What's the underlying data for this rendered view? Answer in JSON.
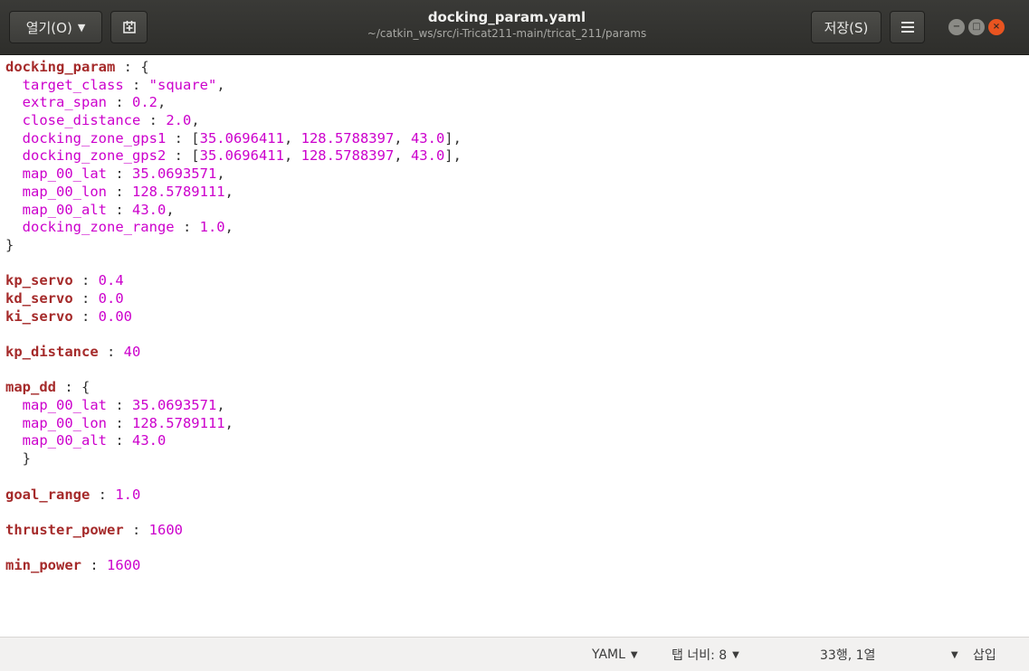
{
  "headerbar": {
    "open_label": "열기(O)",
    "pin_icon": "new-tab-icon",
    "title": "docking_param.yaml",
    "subtitle": "~/catkin_ws/src/i-Tricat211-main/tricat_211/params",
    "save_label": "저장(S)",
    "menu_icon": "hamburger-menu-icon"
  },
  "window_controls": {
    "minimize": "−",
    "maximize": "□",
    "close": "×"
  },
  "editor": {
    "lines": [
      [
        {
          "t": "docking_param",
          "c": "key-top"
        },
        {
          "t": " : {",
          "c": "punct"
        }
      ],
      [
        {
          "t": "  target_class",
          "c": "key-nested"
        },
        {
          "t": " : ",
          "c": "punct"
        },
        {
          "t": "\"square\"",
          "c": "str"
        },
        {
          "t": ",",
          "c": "punct"
        }
      ],
      [
        {
          "t": "  extra_span",
          "c": "key-nested"
        },
        {
          "t": " : ",
          "c": "punct"
        },
        {
          "t": "0.2",
          "c": "num"
        },
        {
          "t": ",",
          "c": "punct"
        }
      ],
      [
        {
          "t": "  close_distance",
          "c": "key-nested"
        },
        {
          "t": " : ",
          "c": "punct"
        },
        {
          "t": "2.0",
          "c": "num"
        },
        {
          "t": ",",
          "c": "punct"
        }
      ],
      [
        {
          "t": "  docking_zone_gps1",
          "c": "key-nested"
        },
        {
          "t": " : [",
          "c": "punct"
        },
        {
          "t": "35.0696411",
          "c": "num"
        },
        {
          "t": ", ",
          "c": "punct"
        },
        {
          "t": "128.5788397",
          "c": "num"
        },
        {
          "t": ", ",
          "c": "punct"
        },
        {
          "t": "43.0",
          "c": "num"
        },
        {
          "t": "],",
          "c": "punct"
        }
      ],
      [
        {
          "t": "  docking_zone_gps2",
          "c": "key-nested"
        },
        {
          "t": " : [",
          "c": "punct"
        },
        {
          "t": "35.0696411",
          "c": "num"
        },
        {
          "t": ", ",
          "c": "punct"
        },
        {
          "t": "128.5788397",
          "c": "num"
        },
        {
          "t": ", ",
          "c": "punct"
        },
        {
          "t": "43.0",
          "c": "num"
        },
        {
          "t": "],",
          "c": "punct"
        }
      ],
      [
        {
          "t": "  map_00_lat",
          "c": "key-nested"
        },
        {
          "t": " : ",
          "c": "punct"
        },
        {
          "t": "35.0693571",
          "c": "num"
        },
        {
          "t": ",",
          "c": "punct"
        }
      ],
      [
        {
          "t": "  map_00_lon",
          "c": "key-nested"
        },
        {
          "t": " : ",
          "c": "punct"
        },
        {
          "t": "128.5789111",
          "c": "num"
        },
        {
          "t": ",",
          "c": "punct"
        }
      ],
      [
        {
          "t": "  map_00_alt",
          "c": "key-nested"
        },
        {
          "t": " : ",
          "c": "punct"
        },
        {
          "t": "43.0",
          "c": "num"
        },
        {
          "t": ",",
          "c": "punct"
        }
      ],
      [
        {
          "t": "  docking_zone_range",
          "c": "key-nested"
        },
        {
          "t": " : ",
          "c": "punct"
        },
        {
          "t": "1.0",
          "c": "num"
        },
        {
          "t": ",",
          "c": "punct"
        }
      ],
      [
        {
          "t": "}",
          "c": "punct"
        }
      ],
      [],
      [
        {
          "t": "kp_servo",
          "c": "key-top"
        },
        {
          "t": " : ",
          "c": "punct"
        },
        {
          "t": "0.4",
          "c": "num"
        }
      ],
      [
        {
          "t": "kd_servo",
          "c": "key-top"
        },
        {
          "t": " : ",
          "c": "punct"
        },
        {
          "t": "0.0",
          "c": "num"
        }
      ],
      [
        {
          "t": "ki_servo",
          "c": "key-top"
        },
        {
          "t": " : ",
          "c": "punct"
        },
        {
          "t": "0.00",
          "c": "num"
        }
      ],
      [],
      [
        {
          "t": "kp_distance",
          "c": "key-top"
        },
        {
          "t": " : ",
          "c": "punct"
        },
        {
          "t": "40",
          "c": "num"
        }
      ],
      [],
      [
        {
          "t": "map_dd",
          "c": "key-top"
        },
        {
          "t": " : {",
          "c": "punct"
        }
      ],
      [
        {
          "t": "  map_00_lat",
          "c": "key-nested"
        },
        {
          "t": " : ",
          "c": "punct"
        },
        {
          "t": "35.0693571",
          "c": "num"
        },
        {
          "t": ",",
          "c": "punct"
        }
      ],
      [
        {
          "t": "  map_00_lon",
          "c": "key-nested"
        },
        {
          "t": " : ",
          "c": "punct"
        },
        {
          "t": "128.5789111",
          "c": "num"
        },
        {
          "t": ",",
          "c": "punct"
        }
      ],
      [
        {
          "t": "  map_00_alt",
          "c": "key-nested"
        },
        {
          "t": " : ",
          "c": "punct"
        },
        {
          "t": "43.0",
          "c": "num"
        }
      ],
      [
        {
          "t": "  }",
          "c": "punct"
        }
      ],
      [],
      [
        {
          "t": "goal_range",
          "c": "key-top"
        },
        {
          "t": " : ",
          "c": "punct"
        },
        {
          "t": "1.0",
          "c": "num"
        }
      ],
      [],
      [
        {
          "t": "thruster_power",
          "c": "key-top"
        },
        {
          "t": " : ",
          "c": "punct"
        },
        {
          "t": "1600",
          "c": "num"
        }
      ],
      [],
      [
        {
          "t": "min_power",
          "c": "key-top"
        },
        {
          "t": " : ",
          "c": "punct"
        },
        {
          "t": "1600",
          "c": "num"
        }
      ],
      [],
      [],
      []
    ]
  },
  "statusbar": {
    "language": "YAML",
    "tab_width": "탭 너비: 8",
    "cursor_position": "33행, 1열",
    "insert_mode": "삽입"
  },
  "colors": {
    "top_key": "#a52a2a",
    "value": "#cc00cc",
    "headerbar_bg": "#3a3a37",
    "close_button": "#e95420"
  }
}
